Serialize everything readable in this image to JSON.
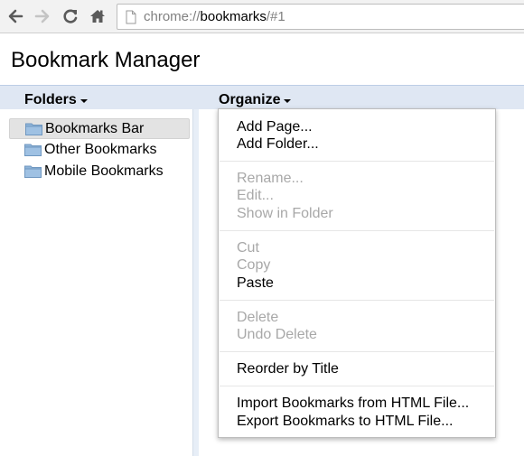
{
  "browser": {
    "url_scheme": "chrome://",
    "url_host": "bookmarks",
    "url_path": "/#1"
  },
  "page": {
    "title": "Bookmark Manager"
  },
  "header": {
    "folders_label": "Folders",
    "organize_label": "Organize"
  },
  "tree": {
    "items": [
      {
        "label": "Bookmarks Bar",
        "selected": true
      },
      {
        "label": "Other Bookmarks",
        "selected": false
      },
      {
        "label": "Mobile Bookmarks",
        "selected": false
      }
    ]
  },
  "organize_menu": {
    "groups": [
      [
        {
          "label": "Add Page...",
          "enabled": true
        },
        {
          "label": "Add Folder...",
          "enabled": true
        }
      ],
      [
        {
          "label": "Rename...",
          "enabled": false
        },
        {
          "label": "Edit...",
          "enabled": false
        },
        {
          "label": "Show in Folder",
          "enabled": false
        }
      ],
      [
        {
          "label": "Cut",
          "enabled": false
        },
        {
          "label": "Copy",
          "enabled": false
        },
        {
          "label": "Paste",
          "enabled": true
        }
      ],
      [
        {
          "label": "Delete",
          "enabled": false
        },
        {
          "label": "Undo Delete",
          "enabled": false
        }
      ],
      [
        {
          "label": "Reorder by Title",
          "enabled": true
        }
      ],
      [
        {
          "label": "Import Bookmarks from HTML File...",
          "enabled": true
        },
        {
          "label": "Export Bookmarks to HTML File...",
          "enabled": true
        }
      ]
    ]
  },
  "colors": {
    "header_bar": "#dfe7f3",
    "folder_icon": "#8fb4d9",
    "disabled_text": "#a8a8a8"
  }
}
